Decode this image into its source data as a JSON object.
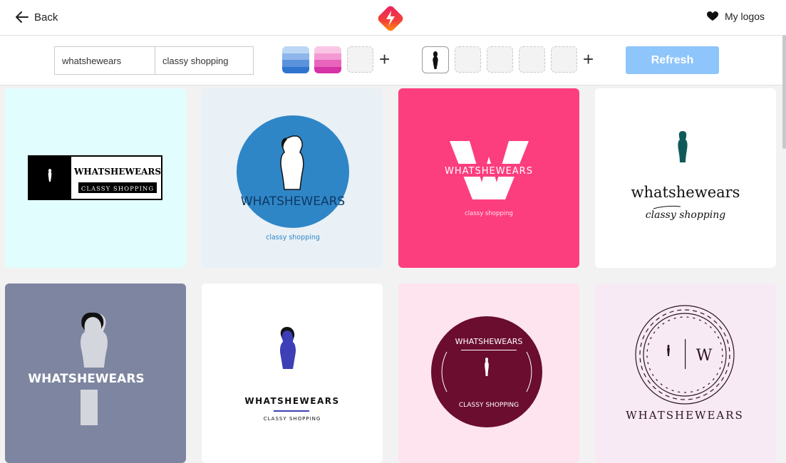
{
  "nav": {
    "back_label": "Back",
    "my_logos_label": "My logos"
  },
  "toolbar": {
    "name_value": "whatshewears",
    "slogan_value": "classy shopping",
    "refresh_label": "Refresh"
  },
  "watermark": "turbologo",
  "logos": [
    {
      "name": "WHATSHEWEARS",
      "tagline": "CLASSY SHOPPING",
      "bg": "#e2fdfd"
    },
    {
      "name": "WHATSHEWEARS",
      "tagline": "classy shopping",
      "bg": "#e9f0f6"
    },
    {
      "name": "WHATSHEWEARS",
      "tagline": "classy shopping",
      "bg": "#fd3e7e"
    },
    {
      "name": "whatshewears",
      "tagline": "classy shopping",
      "bg": "#ffffff"
    },
    {
      "name": "WHATSHEWEARS",
      "tagline": "",
      "bg": "#7d85a0"
    },
    {
      "name": "WHATSHEWEARS",
      "tagline": "CLASSY SHOPPING",
      "bg": "#ffffff"
    },
    {
      "name": "WHATSHEWEARS",
      "tagline": "CLASSY SHOPPING",
      "bg": "#fde4ef"
    },
    {
      "name": "WHATSHEWEARS",
      "tagline": "",
      "bg": "#f8eaf4"
    }
  ],
  "colors": {
    "accent": "#8ec5fa",
    "palette_blue": [
      "#bcd6f5",
      "#8eb6ea",
      "#5a93dc",
      "#2f74cf"
    ],
    "palette_pink": [
      "#f9c6e6",
      "#f39ad4",
      "#e864bd",
      "#d633a7"
    ]
  }
}
